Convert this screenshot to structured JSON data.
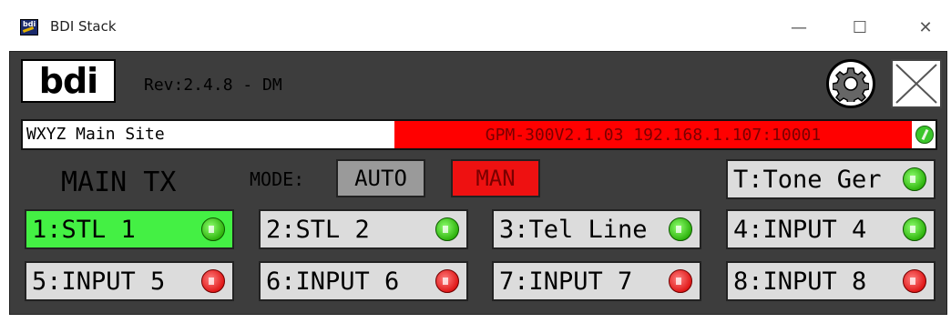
{
  "window": {
    "title": "BDI Stack",
    "minimize": "—",
    "maximize": "☐",
    "close": "✕"
  },
  "header": {
    "logo": "bdi",
    "revision": "Rev:2.4.8 - DM"
  },
  "status": {
    "site": "WXYZ Main Site",
    "connection": "GPM-300V2.1.03 192.168.1.107:10001",
    "connection_color": "#ff0000",
    "link_status_color": "#3bc62b"
  },
  "station": {
    "name": "MAIN TX"
  },
  "mode": {
    "label": "MODE:",
    "auto": "AUTO",
    "manual": "MAN",
    "active": "MAN"
  },
  "tone": {
    "label": "T:Tone Ger",
    "status": "green"
  },
  "inputs": [
    {
      "label": "1:STL 1",
      "status": "green",
      "active": true
    },
    {
      "label": "2:STL 2",
      "status": "green",
      "active": false
    },
    {
      "label": "3:Tel Line",
      "status": "green",
      "active": false
    },
    {
      "label": "4:INPUT 4",
      "status": "green",
      "active": false
    },
    {
      "label": "5:INPUT 5",
      "status": "red",
      "active": false
    },
    {
      "label": "6:INPUT 6",
      "status": "red",
      "active": false
    },
    {
      "label": "7:INPUT 7",
      "status": "red",
      "active": false
    },
    {
      "label": "8:INPUT 8",
      "status": "red",
      "active": false
    }
  ]
}
